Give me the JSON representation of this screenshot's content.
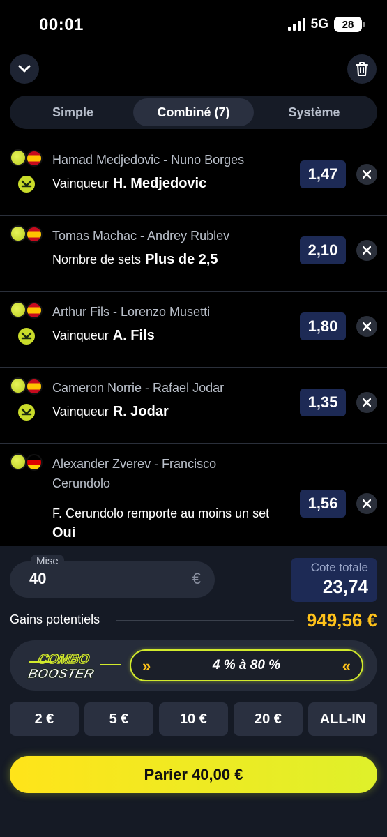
{
  "status": {
    "time": "00:01",
    "network": "5G",
    "battery": "28"
  },
  "tabs": [
    "Simple",
    "Combiné (7)",
    "Système"
  ],
  "bets": [
    {
      "match": "Hamad Medjedovic - Nuno Borges",
      "market": "Vainqueur",
      "selection": "H. Medjedovic",
      "odds": "1,47"
    },
    {
      "match": "Tomas Machac - Andrey Rublev",
      "market": "Nombre de sets",
      "selection": "Plus de 2,5",
      "odds": "2,10"
    },
    {
      "match": "Arthur Fils - Lorenzo Musetti",
      "market": "Vainqueur",
      "selection": "A. Fils",
      "odds": "1,80"
    },
    {
      "match": "Cameron Norrie - Rafael Jodar",
      "market": "Vainqueur",
      "selection": "R. Jodar",
      "odds": "1,35"
    },
    {
      "match": "Alexander Zverev - Francisco Cerundolo",
      "market": "F. Cerundolo remporte au moins un set",
      "selection": "Oui",
      "odds": "1,56"
    }
  ],
  "stake": {
    "label": "Mise",
    "value": "40",
    "currency": "€"
  },
  "total_odds": {
    "label": "Cote totale",
    "value": "23,74"
  },
  "gains": {
    "label": "Gains potentiels",
    "value": "949,56 €"
  },
  "booster": {
    "logo_line1": "COMBO",
    "logo_line2": "BOOSTER",
    "range": "4 % à 80 %"
  },
  "quick_stakes": [
    "2 €",
    "5 €",
    "10 €",
    "20 €",
    "ALL-IN"
  ],
  "place_bet": "Parier 40,00 €",
  "colors": {
    "accent_yellow": "#ffc21a",
    "button_gradient_start": "#ffe41a",
    "odds_bg": "#1d2a55",
    "panel_bg": "#151a25"
  }
}
